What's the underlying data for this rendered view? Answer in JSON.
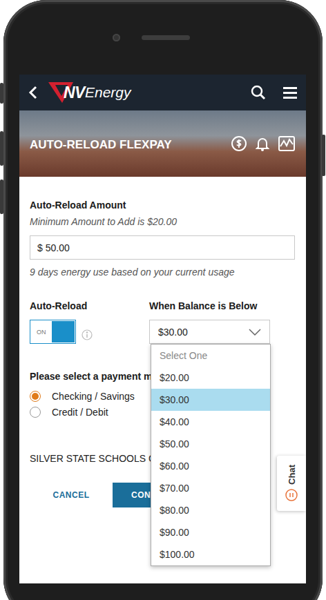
{
  "logo": {
    "bold": "NV",
    "rest": "Energy"
  },
  "page_title": "AUTO-RELOAD FLEXPAY",
  "amount": {
    "label": "Auto-Reload Amount",
    "hint": "Minimum Amount to Add is $20.00",
    "value": "$ 50.00",
    "note": "9 days energy use based on your current usage"
  },
  "auto_reload": {
    "label": "Auto-Reload",
    "on": true,
    "toggle_text": "ON"
  },
  "threshold": {
    "label": "When Balance is Below",
    "value": "$30.00",
    "expanded": true,
    "options": [
      {
        "label": "Select One",
        "selected": false,
        "disabled": true
      },
      {
        "label": "$20.00",
        "selected": false,
        "disabled": false
      },
      {
        "label": "$30.00",
        "selected": true,
        "disabled": false
      },
      {
        "label": "$40.00",
        "selected": false,
        "disabled": false
      },
      {
        "label": "$50.00",
        "selected": false,
        "disabled": false
      },
      {
        "label": "$60.00",
        "selected": false,
        "disabled": false
      },
      {
        "label": "$70.00",
        "selected": false,
        "disabled": false
      },
      {
        "label": "$80.00",
        "selected": false,
        "disabled": false
      },
      {
        "label": "$90.00",
        "selected": false,
        "disabled": false
      },
      {
        "label": "$100.00",
        "selected": false,
        "disabled": false
      }
    ]
  },
  "payment": {
    "label": "Please select a payment m",
    "options": [
      {
        "label": "Checking / Savings",
        "selected": true
      },
      {
        "label": "Credit / Debit",
        "selected": false
      }
    ]
  },
  "account": "SILVER STATE SCHOOLS CR",
  "buttons": {
    "cancel": "CANCEL",
    "continue": "CON"
  },
  "chat": "Chat"
}
